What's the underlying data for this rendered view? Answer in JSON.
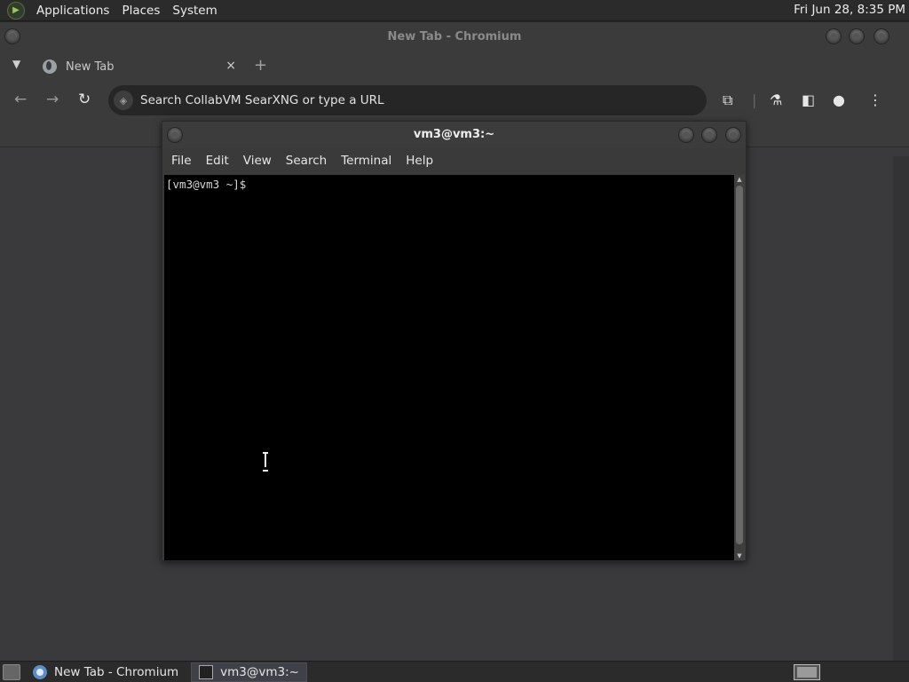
{
  "top_panel": {
    "menus": [
      "Applications",
      "Places",
      "System"
    ],
    "clock": "Fri Jun 28,  8:35 PM"
  },
  "chromium": {
    "window_title": "New Tab - Chromium",
    "tab": {
      "title": "New Tab",
      "close": "×"
    },
    "new_tab": "+",
    "omnibox": {
      "placeholder": "Search CollabVM SearXNG or type a URL"
    }
  },
  "terminal": {
    "window_title": "vm3@vm3:~",
    "menus": [
      "File",
      "Edit",
      "View",
      "Search",
      "Terminal",
      "Help"
    ],
    "prompt": "[vm3@vm3 ~]$"
  },
  "taskbar": {
    "tasks": [
      {
        "label": "New Tab - Chromium",
        "icon": "chromium-icon",
        "active": false
      },
      {
        "label": "vm3@vm3:~",
        "icon": "terminal-icon",
        "active": true
      }
    ]
  }
}
